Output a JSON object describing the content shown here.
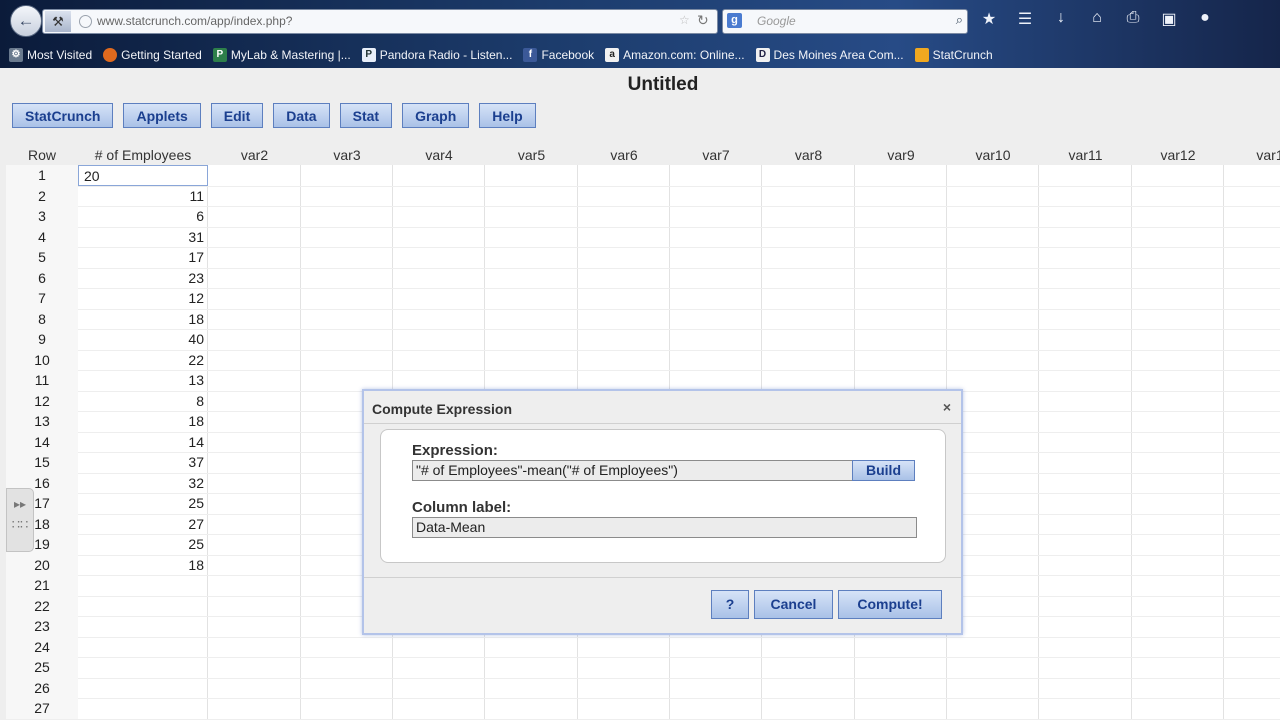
{
  "browser": {
    "url": "www.statcrunch.com/app/index.php?",
    "search_placeholder": "Google",
    "bookmarks": [
      {
        "label": "Most Visited",
        "icon": "gear-icon"
      },
      {
        "label": "Getting Started",
        "icon": "firefox-icon"
      },
      {
        "label": "MyLab & Mastering |...",
        "icon": "p-icon"
      },
      {
        "label": "Pandora Radio - Listen...",
        "icon": "p-icon"
      },
      {
        "label": "Facebook",
        "icon": "facebook-icon"
      },
      {
        "label": "Amazon.com: Online...",
        "icon": "amazon-icon"
      },
      {
        "label": "Des Moines Area Com...",
        "icon": "d-icon"
      },
      {
        "label": "StatCrunch",
        "icon": "statcrunch-icon"
      }
    ]
  },
  "app": {
    "title": "Untitled",
    "menu": [
      "StatCrunch",
      "Applets",
      "Edit",
      "Data",
      "Stat",
      "Graph",
      "Help"
    ]
  },
  "grid": {
    "row_header": "Row",
    "columns": [
      "# of Employees",
      "var2",
      "var3",
      "var4",
      "var5",
      "var6",
      "var7",
      "var8",
      "var9",
      "var10",
      "var11",
      "var12",
      "var1"
    ],
    "rows": [
      "1",
      "2",
      "3",
      "4",
      "5",
      "6",
      "7",
      "8",
      "9",
      "10",
      "11",
      "12",
      "13",
      "14",
      "15",
      "16",
      "17",
      "18",
      "19",
      "20",
      "21",
      "22",
      "23",
      "24",
      "25",
      "26",
      "27"
    ],
    "employees": [
      "20",
      "11",
      "6",
      "31",
      "17",
      "23",
      "12",
      "18",
      "40",
      "22",
      "13",
      "8",
      "18",
      "14",
      "37",
      "32",
      "25",
      "27",
      "25",
      "18"
    ]
  },
  "dialog": {
    "title": "Compute Expression",
    "close": "×",
    "expression_label": "Expression:",
    "expression_value": "\"# of Employees\"-mean(\"# of Employees\")",
    "build": "Build",
    "column_label_label": "Column label:",
    "column_label_value": "Data-Mean",
    "help": "?",
    "cancel": "Cancel",
    "compute": "Compute!"
  }
}
